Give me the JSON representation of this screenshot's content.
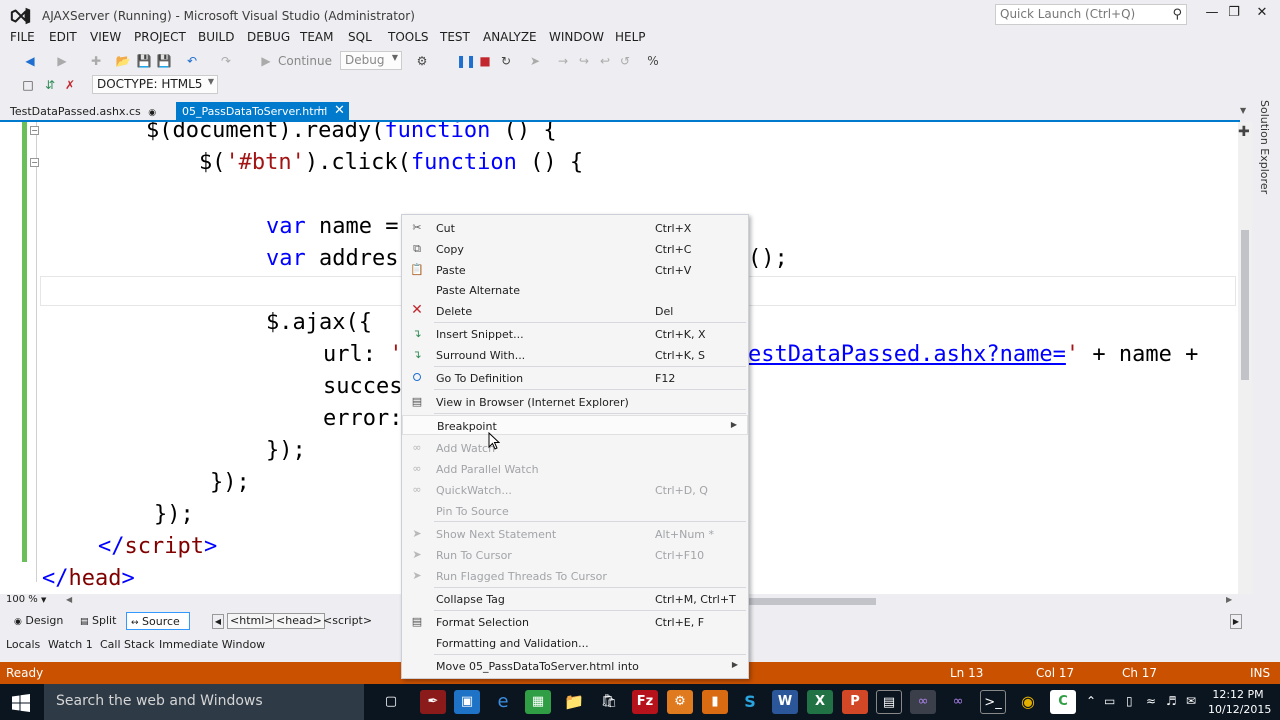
{
  "window": {
    "title": "AJAXServer (Running) - Microsoft Visual Studio (Administrator)",
    "quick_launch_placeholder": "Quick Launch (Ctrl+Q)"
  },
  "menu": [
    "FILE",
    "EDIT",
    "VIEW",
    "PROJECT",
    "BUILD",
    "DEBUG",
    "TEAM",
    "SQL",
    "TOOLS",
    "TEST",
    "ANALYZE",
    "WINDOW",
    "HELP"
  ],
  "toolbar": {
    "continue_label": "Continue",
    "config_value": "Debug",
    "doctype_value": "DOCTYPE: HTML5"
  },
  "tabs": [
    {
      "label": "TestDataPassed.ashx.cs"
    },
    {
      "label": "05_PassDataToServer.html"
    }
  ],
  "code": {
    "l1": {
      "a": "        $(document).ready(",
      "kw": "function",
      "b": " () {"
    },
    "l2": {
      "a": "            $(",
      "str": "'#btn'",
      "b": ").click(",
      "kw": "function",
      "c": " () {"
    },
    "l4": {
      "kw": "var",
      "a": " name ="
    },
    "l5": {
      "kw": "var",
      "a": " addres",
      "tail": "();"
    },
    "l7": {
      "a": "$.ajax({"
    },
    "l8": {
      "a": "url: ",
      "q": "'",
      "link": "estDataPassed.ashx?name=",
      "q2": "'",
      "b": " + name +"
    },
    "l9": {
      "a": "succes",
      "tail": ","
    },
    "l10": {
      "a": "error:"
    },
    "l11": {
      "a": "});"
    },
    "l12": {
      "a": "});"
    },
    "l13": {
      "a": "});"
    },
    "l14": {
      "open": "</",
      "tag": "script",
      "close": ">"
    },
    "l15": {
      "open": "</",
      "tag": "head",
      "close": ">"
    }
  },
  "editor": {
    "zoom": "100 %"
  },
  "solution_explorer_label": "Solution Explorer",
  "view_switch": {
    "design": "Design",
    "split": "Split",
    "source": "Source"
  },
  "breadcrumbs": [
    "<html>",
    "<head>",
    "<script>"
  ],
  "debug_tabs": [
    "Locals",
    "Watch 1",
    "Call Stack",
    "Immediate Window"
  ],
  "status": {
    "ready": "Ready",
    "ln": "Ln 13",
    "col": "Col 17",
    "ch": "Ch 17",
    "ins": "INS"
  },
  "taskbar": {
    "search_placeholder": "Search the web and Windows",
    "time": "12:12 PM",
    "date": "10/12/2015"
  },
  "context_menu": {
    "items": [
      {
        "label": "Cut",
        "shortcut": "Ctrl+X",
        "icon": "scissors-icon"
      },
      {
        "label": "Copy",
        "shortcut": "Ctrl+C",
        "icon": "copy-icon"
      },
      {
        "label": "Paste",
        "shortcut": "Ctrl+V",
        "icon": "paste-icon"
      },
      {
        "label": "Paste Alternate",
        "shortcut": ""
      },
      {
        "label": "Delete",
        "shortcut": "Del",
        "icon": "delete-x-icon"
      },
      {
        "label": "Insert Snippet...",
        "shortcut": "Ctrl+K, X",
        "icon": "snippet-icon"
      },
      {
        "label": "Surround With...",
        "shortcut": "Ctrl+K, S",
        "icon": "surround-icon"
      },
      {
        "label": "Go To Definition",
        "shortcut": "F12",
        "icon": "goto-definition-icon"
      },
      {
        "label": "View in Browser (Internet Explorer)",
        "shortcut": "",
        "icon": "browser-icon"
      },
      {
        "label": "Breakpoint",
        "shortcut": "",
        "submenu": true
      },
      {
        "label": "Add Watch",
        "shortcut": "",
        "disabled": true,
        "icon": "watch-glasses-icon"
      },
      {
        "label": "Add Parallel Watch",
        "shortcut": "",
        "disabled": true,
        "icon": "parallel-watch-icon"
      },
      {
        "label": "QuickWatch...",
        "shortcut": "Ctrl+D, Q",
        "disabled": true,
        "icon": "quickwatch-icon"
      },
      {
        "label": "Pin To Source",
        "shortcut": "",
        "disabled": true
      },
      {
        "label": "Show Next Statement",
        "shortcut": "Alt+Num *",
        "disabled": true,
        "icon": "next-statement-icon"
      },
      {
        "label": "Run To Cursor",
        "shortcut": "Ctrl+F10",
        "disabled": true,
        "icon": "run-to-cursor-icon"
      },
      {
        "label": "Run Flagged Threads To Cursor",
        "shortcut": "",
        "disabled": true,
        "icon": "flagged-threads-icon"
      },
      {
        "label": "Collapse Tag",
        "shortcut": "Ctrl+M, Ctrl+T"
      },
      {
        "label": "Format Selection",
        "shortcut": "Ctrl+E, F",
        "icon": "format-icon"
      },
      {
        "label": "Formatting and Validation...",
        "shortcut": ""
      },
      {
        "label": "Move 05_PassDataToServer.html into",
        "shortcut": "",
        "submenu": true
      }
    ]
  }
}
